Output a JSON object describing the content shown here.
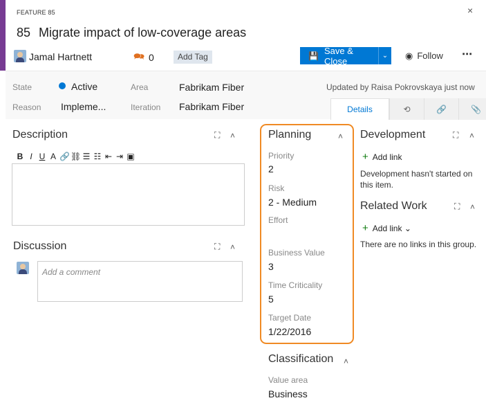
{
  "header": {
    "work_item_type": "FEATURE 85",
    "id": "85",
    "title": "Migrate impact of low-coverage areas",
    "close_glyph": "×",
    "owner": "Jamal Hartnett",
    "comment_count": "0",
    "add_tag": "Add Tag",
    "save_close": "Save & Close",
    "follow": "Follow",
    "more": "⋯",
    "accent_color": "#773b93"
  },
  "fields": {
    "state_label": "State",
    "state_value": "Active",
    "reason_label": "Reason",
    "reason_value": "Impleme...",
    "area_label": "Area",
    "area_value": "Fabrikam Fiber",
    "iteration_label": "Iteration",
    "iteration_value": "Fabrikam Fiber",
    "updated_text": "Updated by Raisa Pokrovskaya  just now"
  },
  "tabs": {
    "details": "Details",
    "icons": [
      "history-icon",
      "links-icon",
      "attachment-icon"
    ]
  },
  "description": {
    "title": "Description",
    "toolbar": [
      "B",
      "I",
      "U",
      "A",
      "link",
      "unlink",
      "bullets",
      "numbers",
      "outdent",
      "indent",
      "image"
    ]
  },
  "discussion": {
    "title": "Discussion",
    "placeholder": "Add a comment"
  },
  "planning": {
    "title": "Planning",
    "priority_label": "Priority",
    "priority_value": "2",
    "risk_label": "Risk",
    "risk_value": "2 - Medium",
    "effort_label": "Effort",
    "effort_value": "",
    "business_value_label": "Business Value",
    "business_value_value": "3",
    "time_criticality_label": "Time Criticality",
    "time_criticality_value": "5",
    "target_date_label": "Target Date",
    "target_date_value": "1/22/2016",
    "highlight_color": "#f08a24"
  },
  "classification": {
    "title": "Classification",
    "value_area_label": "Value area",
    "value_area_value": "Business"
  },
  "development": {
    "title": "Development",
    "add_link": "Add link",
    "message": "Development hasn't started on this item."
  },
  "related_work": {
    "title": "Related Work",
    "add_link": "Add link",
    "message": "There are no links in this group."
  }
}
